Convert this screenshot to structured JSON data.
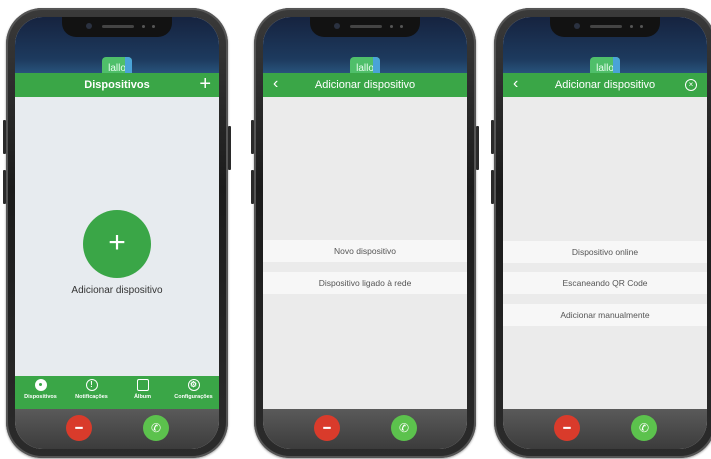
{
  "colors": {
    "accent": "#3aa647",
    "decline": "#d93b2b",
    "accept": "#5cc24d",
    "background": "#ebebeb"
  },
  "phones": [
    {
      "logo": "lallo",
      "title": "Dispositivos",
      "right_icon": "plus-icon",
      "add_label": "Adicionar dispositivo",
      "nav": [
        {
          "label": "Dispositivos",
          "icon": "camera-icon"
        },
        {
          "label": "Notificações",
          "icon": "alert-icon"
        },
        {
          "label": "Álbum",
          "icon": "gallery-icon"
        },
        {
          "label": "Configurações",
          "icon": "gear-icon"
        }
      ]
    },
    {
      "logo": "lallo",
      "title": "Adicionar dispositivo",
      "left_icon": "back-chevron-icon",
      "options": [
        "Novo dispositivo",
        "Dispositivo ligado à rede"
      ]
    },
    {
      "logo": "lallo",
      "title": "Adicionar dispositivo",
      "left_icon": "back-chevron-icon",
      "right_icon": "close-circle-icon",
      "options": [
        "Dispositivo online",
        "Escaneando QR Code",
        "Adicionar manualmente"
      ]
    }
  ],
  "call": {
    "decline_icon": "hang-up-icon",
    "accept_icon": "phone-icon"
  }
}
